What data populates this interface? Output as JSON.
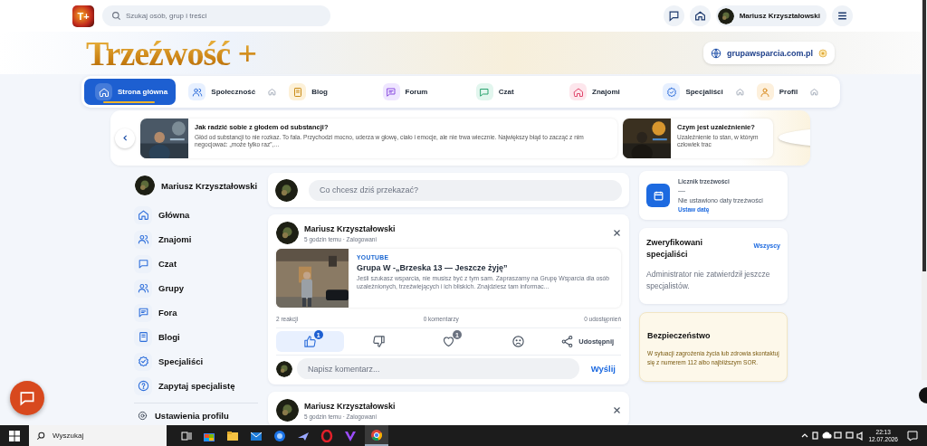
{
  "topbar": {
    "logo_text": "T+",
    "search_placeholder": "Szukaj osób, grup i treści",
    "user_name": "Mariusz Krzyształowski"
  },
  "header": {
    "brand": "Trzeźwość +",
    "site_link": "grupawsparcia.com.pl"
  },
  "nav": [
    {
      "label": "Strona główna",
      "kind": "home",
      "selected": true,
      "trailing_icon": false
    },
    {
      "label": "Społeczność",
      "kind": "people",
      "selected": false,
      "trailing_icon": true
    },
    {
      "label": "Blog",
      "kind": "book",
      "selected": false,
      "trailing_icon": false
    },
    {
      "label": "Forum",
      "kind": "forum",
      "selected": false,
      "trailing_icon": false
    },
    {
      "label": "Czat",
      "kind": "chat",
      "selected": false,
      "trailing_icon": false
    },
    {
      "label": "Znajomi",
      "kind": "house",
      "selected": false,
      "trailing_icon": false
    },
    {
      "label": "Specjaliści",
      "kind": "badge",
      "selected": false,
      "trailing_icon": true
    },
    {
      "label": "Profil",
      "kind": "person",
      "selected": false,
      "trailing_icon": true
    }
  ],
  "carousel": [
    {
      "title": "Jak radzić sobie z głodem od substancji?",
      "excerpt": "Głód od substancji to nie rozkaz. To fala. Przychodzi mocno, uderza w głowę, ciało i emocje, ale nie trwa wiecznie. Największy błąd to zacząć z nim negocjować: „może tylko raz”,…"
    },
    {
      "title": "Czym jest uzależnienie?",
      "excerpt": "Uzależnienie to stan, w którym człowiek trac"
    }
  ],
  "sidebar": {
    "user_name": "Mariusz Krzyształowski",
    "items": [
      {
        "label": "Główna",
        "kind": "home"
      },
      {
        "label": "Znajomi",
        "kind": "people"
      },
      {
        "label": "Czat",
        "kind": "chat"
      },
      {
        "label": "Grupy",
        "kind": "group"
      },
      {
        "label": "Fora",
        "kind": "forum"
      },
      {
        "label": "Blogi",
        "kind": "book"
      },
      {
        "label": "Specjaliści",
        "kind": "badge"
      },
      {
        "label": "Zapytaj specjalistę",
        "kind": "help"
      }
    ],
    "settings": "Ustawienia profilu"
  },
  "composer": {
    "placeholder": "Co chcesz dziś przekazać?"
  },
  "posts": [
    {
      "author": "Mariusz Krzyształowski",
      "meta": "5 godzin temu · Zalogowani",
      "link": {
        "source": "YOUTUBE",
        "title": "Grupa W -„Brzeska 13 — Jeszcze żyję”",
        "description": "Jeśli szukasz wsparcia, nie musisz być z tym sam. Zapraszamy na Grupę Wsparcia dla osób uzależnionych, trzeźwiejących i ich bliskich. Znajdziesz tam informac..."
      },
      "stats": [
        "2 reakcji",
        "0 komentarzy",
        "0 udostępnień"
      ],
      "actions": [
        {
          "kind": "like",
          "count": "1",
          "selected": true
        },
        {
          "kind": "dislike",
          "selected": false
        },
        {
          "kind": "heart",
          "count": "1",
          "selected": false
        },
        {
          "kind": "sad",
          "selected": false
        },
        {
          "kind": "share",
          "label": "Udostępnij",
          "selected": false
        }
      ],
      "comment_placeholder": "Napisz komentarz...",
      "send_label": "Wyślij"
    },
    {
      "author": "Mariusz Krzyształowski",
      "meta": "5 godzin temu · Zalogowani"
    }
  ],
  "sobriety": {
    "title": "Licznik trzeźwości",
    "value": "—",
    "note": "Nie ustawiono daty trzeźwości",
    "action": "Ustaw datę"
  },
  "specialists": {
    "title": "Zweryfikowani specjaliści",
    "link": "Wszyscy",
    "empty": "Administrator nie zatwierdził jeszcze specjalistów."
  },
  "safety": {
    "title": "Bezpieczeństwo",
    "text": "W sytuacji zagrożenia życia lub zdrowia skontaktuj się z numerem 112 albo najbliższym SOR."
  },
  "taskbar": {
    "search_placeholder": "Wyszukaj",
    "time": "22:13",
    "date": "12.07.2026"
  }
}
